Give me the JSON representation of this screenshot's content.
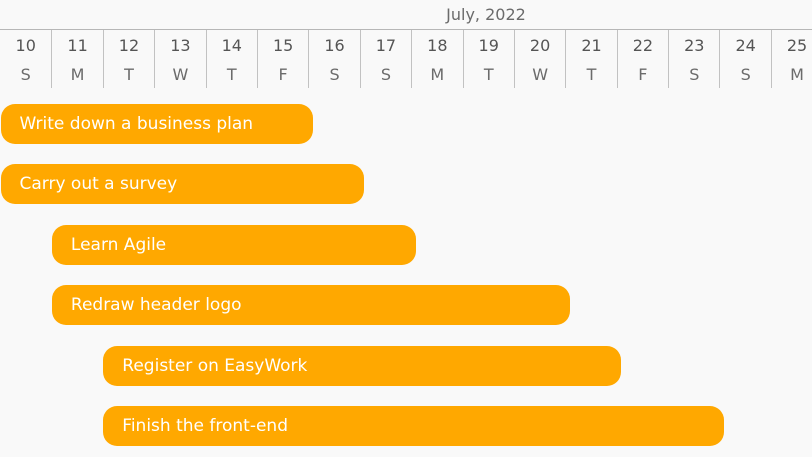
{
  "header": {
    "month_label": "July, 2022"
  },
  "days": [
    {
      "num": "10",
      "wd": "S"
    },
    {
      "num": "11",
      "wd": "M"
    },
    {
      "num": "12",
      "wd": "T"
    },
    {
      "num": "13",
      "wd": "W"
    },
    {
      "num": "14",
      "wd": "T"
    },
    {
      "num": "15",
      "wd": "F"
    },
    {
      "num": "16",
      "wd": "S"
    },
    {
      "num": "17",
      "wd": "S"
    },
    {
      "num": "18",
      "wd": "M"
    },
    {
      "num": "19",
      "wd": "T"
    },
    {
      "num": "20",
      "wd": "W"
    },
    {
      "num": "21",
      "wd": "T"
    },
    {
      "num": "22",
      "wd": "F"
    },
    {
      "num": "23",
      "wd": "S"
    },
    {
      "num": "24",
      "wd": "S"
    },
    {
      "num": "25",
      "wd": "M"
    }
  ],
  "tasks": [
    {
      "label": "Write down a business plan",
      "start": "2022-07-10",
      "end": "2022-07-16"
    },
    {
      "label": "Carry out a survey",
      "start": "2022-07-10",
      "end": "2022-07-17"
    },
    {
      "label": "Learn Agile",
      "start": "2022-07-11",
      "end": "2022-07-18"
    },
    {
      "label": "Redraw header logo",
      "start": "2022-07-11",
      "end": "2022-07-21"
    },
    {
      "label": "Register on EasyWork",
      "start": "2022-07-12",
      "end": "2022-07-22"
    },
    {
      "label": "Finish the front-end",
      "start": "2022-07-12",
      "end": "2022-07-24"
    }
  ],
  "colors": {
    "bar": "#ffa800",
    "bar_text": "#ffffff",
    "background": "#f9f9f9"
  }
}
